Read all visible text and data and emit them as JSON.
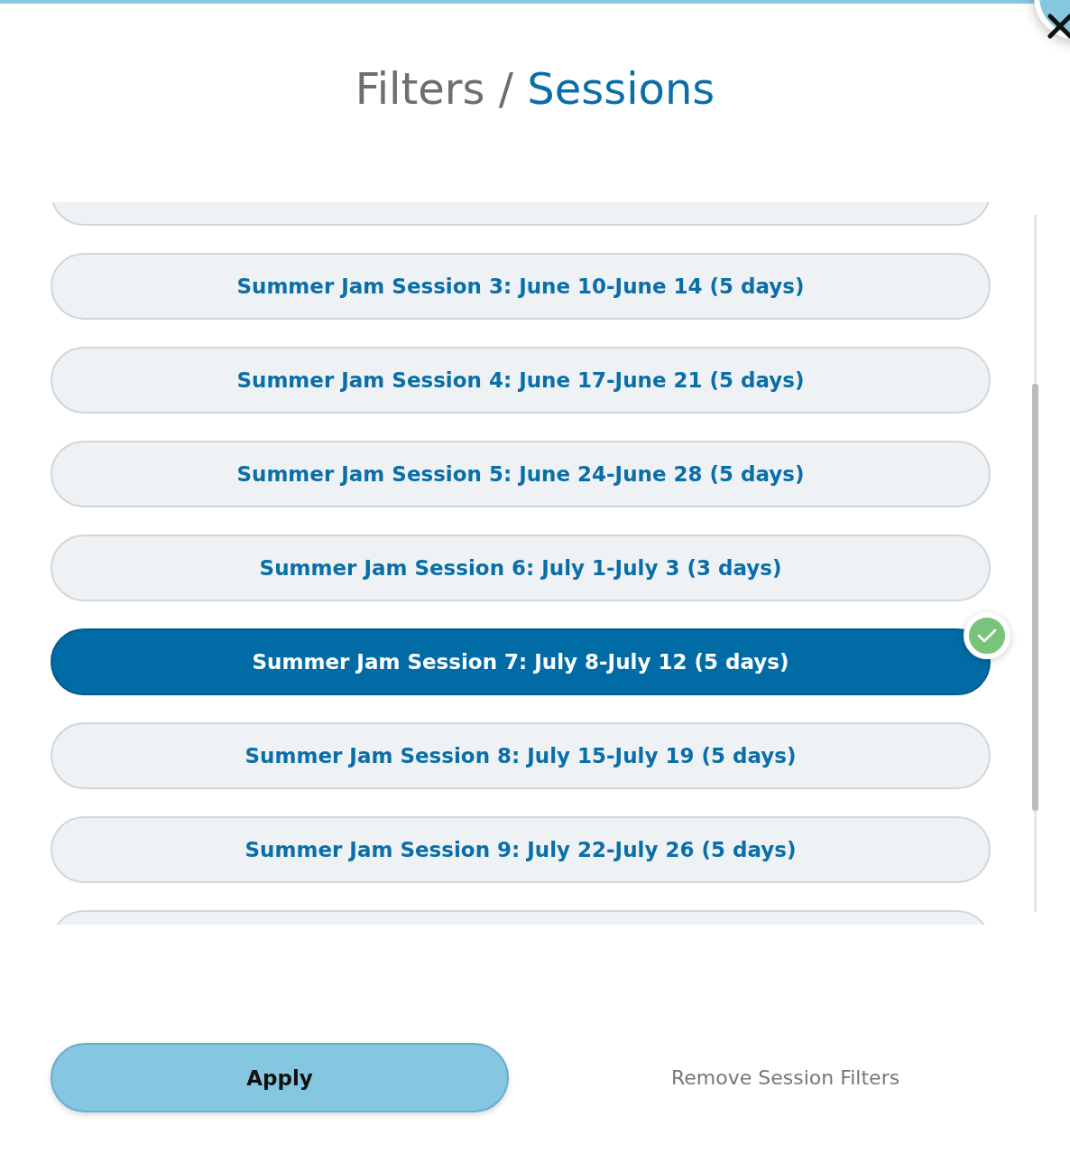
{
  "title": {
    "parent": "Filters /",
    "current": "Sessions"
  },
  "sessions": [
    {
      "label": "Summer Jam Session 3: June 10-June 14 (5 days)",
      "selected": false
    },
    {
      "label": "Summer Jam Session 4: June 17-June 21 (5 days)",
      "selected": false
    },
    {
      "label": "Summer Jam Session 5: June 24-June 28 (5 days)",
      "selected": false
    },
    {
      "label": "Summer Jam Session 6: July 1-July 3 (3 days)",
      "selected": false
    },
    {
      "label": "Summer Jam Session 7: July 8-July 12 (5 days)",
      "selected": true
    },
    {
      "label": "Summer Jam Session 8: July 15-July 19 (5 days)",
      "selected": false
    },
    {
      "label": "Summer Jam Session 9: July 22-July 26 (5 days)",
      "selected": false
    }
  ],
  "apply_button": "Apply",
  "remove_link": "Remove Session Filters"
}
